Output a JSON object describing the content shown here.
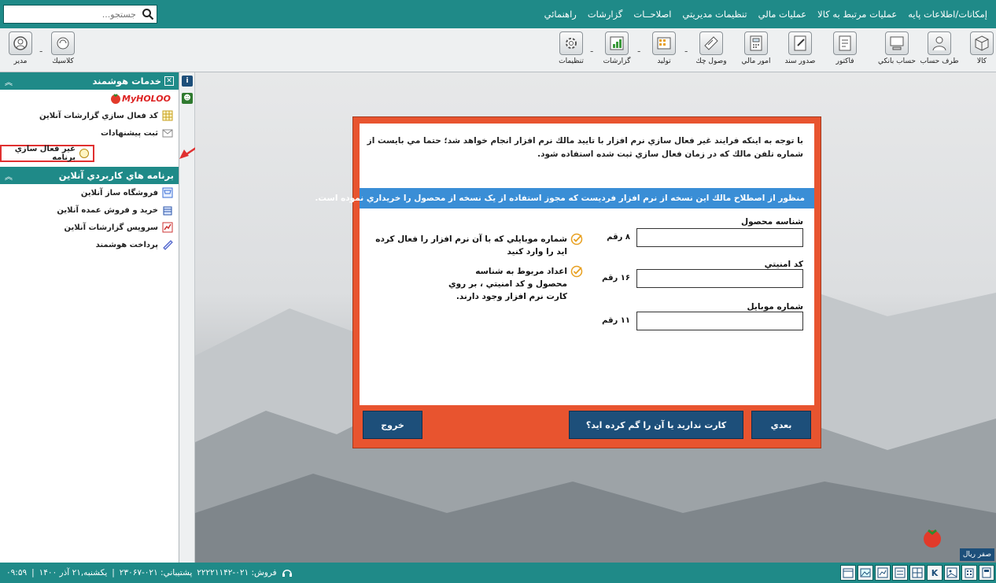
{
  "search": {
    "placeholder": "جستجو..."
  },
  "menu": {
    "items": [
      "إمكانات/اطلاعات پايه",
      "عمليات مرتبط به كالا",
      "عمليات مالي",
      "تنظيمات مديريتي",
      "اصلاحــات",
      "گزارشات",
      "راهنمائي"
    ]
  },
  "toolbar": {
    "right_buttons": [
      {
        "label": "كالا",
        "icon": "box-icon"
      },
      {
        "label": "طرف حساب",
        "icon": "person-icon"
      },
      {
        "label": "حساب بانكي",
        "icon": "bank-icon"
      },
      {
        "label": "فاكتور",
        "icon": "invoice-icon"
      },
      {
        "label": "صدور سند",
        "icon": "document-icon"
      },
      {
        "label": "امور مالي",
        "icon": "calculator-icon"
      },
      {
        "label": "وصول چك",
        "icon": "check-icon"
      },
      {
        "label": "توليد",
        "icon": "factory-icon"
      },
      {
        "label": "گزارشات",
        "icon": "report-icon"
      },
      {
        "label": "تنظيمات",
        "icon": "gear-icon"
      }
    ],
    "left_buttons": [
      {
        "label": "كلاسيك",
        "icon": "classic-icon"
      },
      {
        "label": "مدير",
        "icon": "manager-icon"
      }
    ]
  },
  "smart_services": {
    "title": "خدمات هوشمند",
    "brand": "MyHOLOO",
    "items": [
      "كد فعال سازي گزارشات آنلاين",
      "ثبت پيشنهادات",
      "غير فعال سازي برنامه"
    ]
  },
  "online_apps": {
    "title": "برنامه هاي كاربردي آنلاين",
    "items": [
      "فروشگاه ساز آنلاين",
      "خريد و فروش عمده آنلاين",
      "سرويس گزارشات آنلاين",
      "پرداخت هوشمند"
    ]
  },
  "dialog": {
    "notice": "با توجه به اينكه فرايند غير فعال سازي نرم افزار با تاييد مالك نرم افزار انجام خواهد شد؛ حتما مي بايست از  شماره تلفن مالك كه در زمان فعال سازي ثبت شده استفاده شود.",
    "info": "منظور از اصطلاح مالك اين نسخه از نرم افزار فرديست كه مجوز استفاده از يک نسخه از محصول را خريداري نموده است.",
    "fields": [
      {
        "label": "شناسه محصول",
        "hint": "۸ رقم",
        "value": ""
      },
      {
        "label": "كد امنيتي",
        "hint": "۱۶ رقم",
        "value": ""
      },
      {
        "label": "شماره موبايل",
        "hint": "۱۱ رقم",
        "value": ""
      }
    ],
    "tips": [
      "شماره موبايلي كه با آن نرم افزار را فعال كرده ايد را وارد كنيد",
      "اعداد مربوط به شناسه محصول و كد امنيتي ، بر روي كارت نرم افزار وجود دارند."
    ],
    "buttons": {
      "next": "بعدي",
      "lost_card": "كارت نداريد يا آن را گم كرده ايد؟",
      "exit": "خروج"
    }
  },
  "status": {
    "sales": "فروش: ۰۲۱-۲۲۲۲۱۱۴۲",
    "support": "پشتيباني: ۰۲۱-۲۳۰۶۷",
    "date": "يكشنبه,۲۱ آذر ۱۴۰۰",
    "time": "۰۹:۵۹"
  },
  "currency": "صفر ريال",
  "colors": {
    "accent": "#1f8a88",
    "dialog_frame": "#e8542f",
    "dialog_button": "#1d4f7a",
    "info_bar": "#3a8ed6"
  }
}
